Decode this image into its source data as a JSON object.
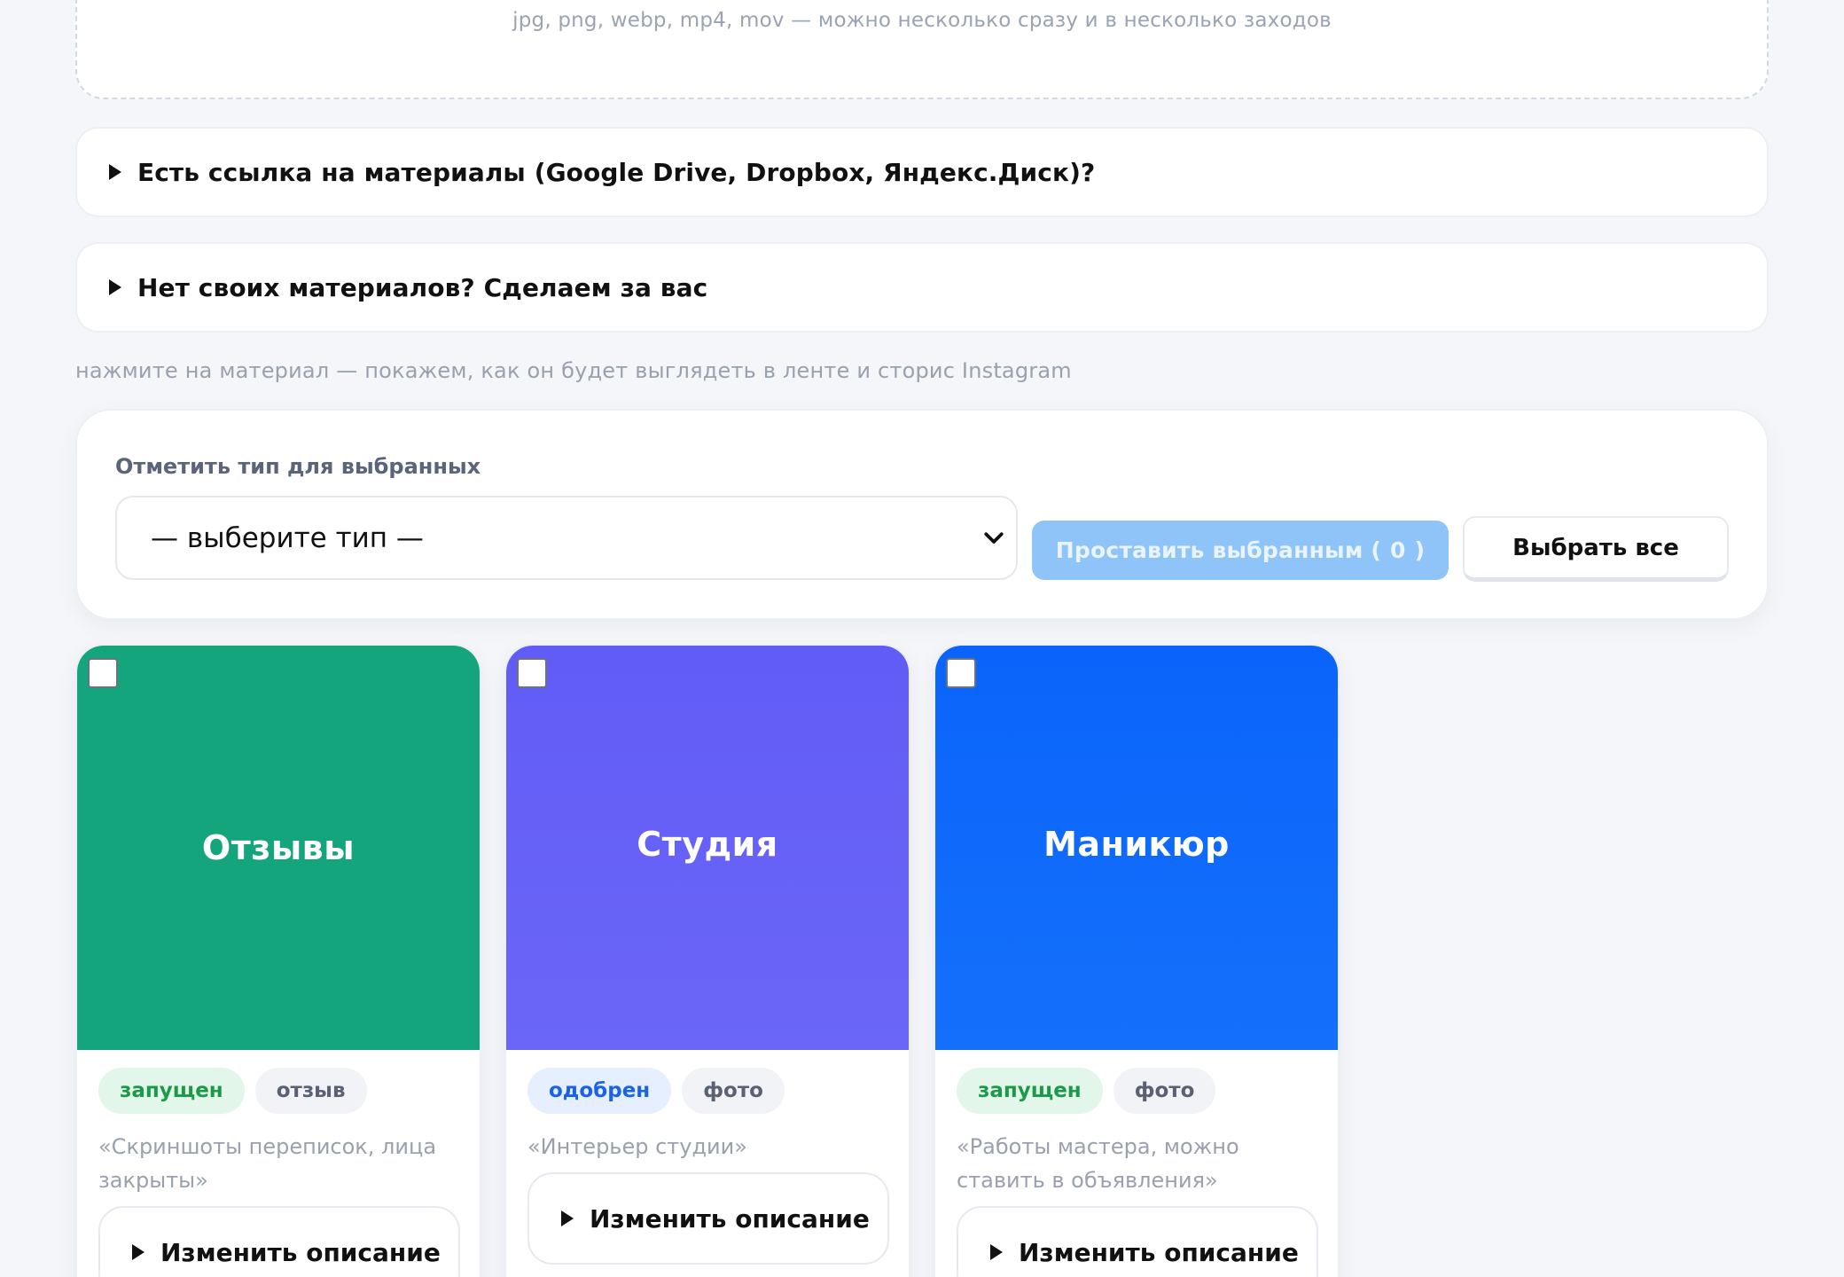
{
  "upload": {
    "formats_hint": "jpg, png, webp, mp4, mov — можно несколько сразу и в несколько заходов"
  },
  "accordions": [
    {
      "label": "Есть ссылка на материалы (Google Drive, Dropbox, Яндекс.Диск)?"
    },
    {
      "label": "Нет своих материалов? Сделаем за вас"
    }
  ],
  "preview_hint": "нажмите на материал — покажем, как он будет выглядеть в ленте и сторис Instagram",
  "bulk": {
    "label": "Отметить тип для выбранных",
    "select_value": "— выберите тип —",
    "apply_label": "Проставить выбранным (",
    "apply_count": "0",
    "apply_close": ")",
    "select_all_label": "Выбрать все"
  },
  "cards": [
    {
      "title": "Отзывы",
      "color": "#14a57d",
      "color_end": "#14a57d",
      "status": "запущен",
      "status_tone": "green",
      "type": "отзыв",
      "description": "«Скриншоты переписок, лица закрыты»",
      "edit_label": "Изменить описание"
    },
    {
      "title": "Студия",
      "color": "#625cf7",
      "color_end": "#6b66f7",
      "status": "одобрен",
      "status_tone": "blue",
      "type": "фото",
      "description": "«Интерьер студии»",
      "edit_label": "Изменить описание"
    },
    {
      "title": "Маникюр",
      "color": "#0a64fb",
      "color_end": "#1470fb",
      "status": "запущен",
      "status_tone": "green",
      "type": "фото",
      "description": "«Работы мастера, можно ставить в объявления»",
      "edit_label": "Изменить описание"
    }
  ]
}
